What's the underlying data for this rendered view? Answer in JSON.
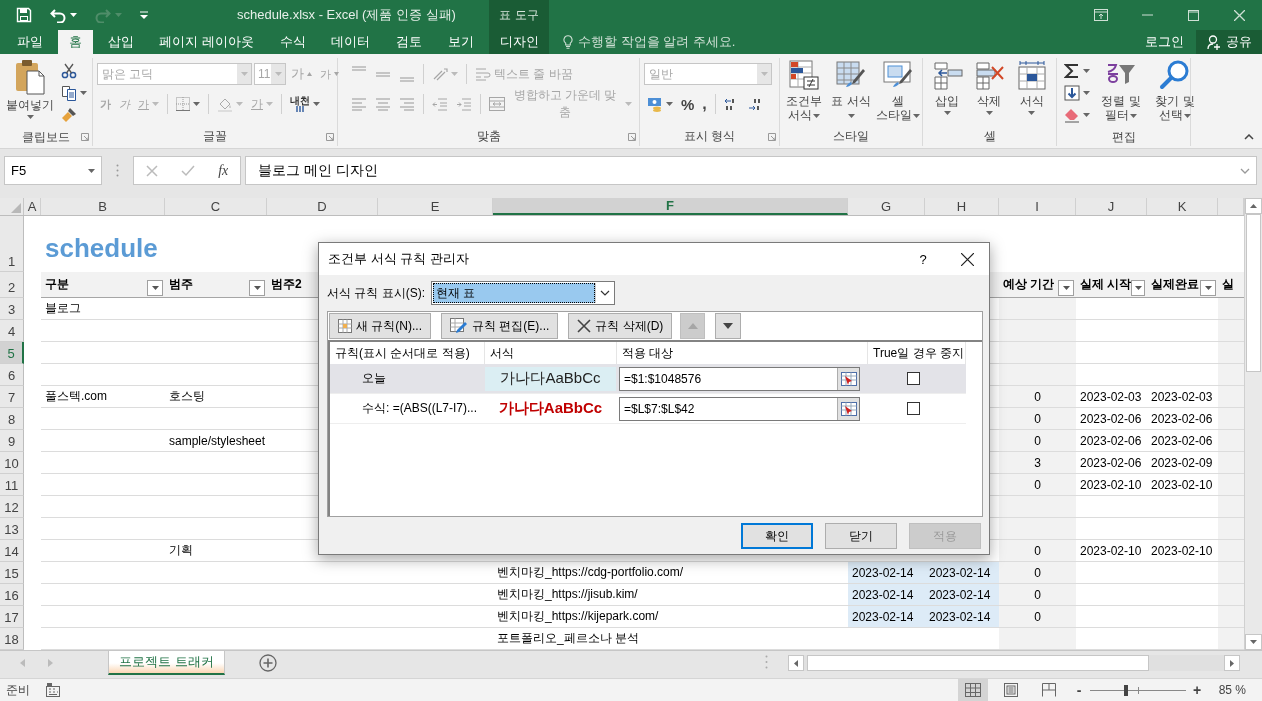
{
  "title_bar": {
    "title": "schedule.xlsx - Excel (제품 인증 실패)",
    "context_label": "표 도구"
  },
  "ribbon_tabs": [
    {
      "label": "파일",
      "selected": false,
      "kind": "normal"
    },
    {
      "label": "홈",
      "selected": true,
      "kind": "normal"
    },
    {
      "label": "삽입",
      "selected": false,
      "kind": "normal"
    },
    {
      "label": "페이지 레이아웃",
      "selected": false,
      "kind": "normal"
    },
    {
      "label": "수식",
      "selected": false,
      "kind": "normal"
    },
    {
      "label": "데이터",
      "selected": false,
      "kind": "normal"
    },
    {
      "label": "검토",
      "selected": false,
      "kind": "normal"
    },
    {
      "label": "보기",
      "selected": false,
      "kind": "normal"
    },
    {
      "label": "디자인",
      "selected": false,
      "kind": "contextual"
    }
  ],
  "tell_me": {
    "placeholder": "수행할 작업을 알려 주세요."
  },
  "account": {
    "login": "로그인",
    "share": "공유"
  },
  "ribbon": {
    "clipboard": {
      "label": "클립보드",
      "paste": "붙여넣기"
    },
    "font": {
      "label": "글꼴",
      "disabled": true,
      "font_name": "맑은 고딕",
      "font_size": "11",
      "grow": "가",
      "shrink": "가",
      "bold": "가",
      "italic": "가",
      "underline": "가",
      "font_color": "가",
      "phonetic": "내천"
    },
    "alignment": {
      "label": "맞춤",
      "disabled": true,
      "wrap_text": "텍스트 줄 바꿈",
      "merge_center": "병합하고 가운데 맞춤"
    },
    "number": {
      "label": "표시 형식",
      "disabled": true,
      "format": "일반",
      "percent": "%",
      "comma": ","
    },
    "styles": {
      "label": "스타일",
      "buttons": [
        "조건부 서식",
        "표 서식",
        "셀 스타일"
      ]
    },
    "cells": {
      "label": "셀",
      "buttons": [
        "삽입",
        "삭제",
        "서식"
      ]
    },
    "editing": {
      "label": "편집",
      "buttons": [
        "정렬 및 필터",
        "찾기 및 선택"
      ]
    }
  },
  "formula_bar": {
    "name_box": "F5",
    "function_button": "fx",
    "formula": "블로그 메인 디자인"
  },
  "sheet": {
    "columns": [
      {
        "label": "A",
        "selected": false
      },
      {
        "label": "B",
        "selected": false,
        "banded": false
      },
      {
        "label": "C",
        "selected": false,
        "banded": false
      },
      {
        "label": "D",
        "selected": false,
        "banded": false
      },
      {
        "label": "E",
        "selected": false,
        "banded": false
      },
      {
        "label": "F",
        "selected": true,
        "banded": false
      },
      {
        "label": "G",
        "selected": false,
        "banded": false
      },
      {
        "label": "H",
        "selected": false,
        "banded": false
      },
      {
        "label": "I",
        "selected": false,
        "banded": true
      },
      {
        "label": "J",
        "selected": false,
        "banded": false
      },
      {
        "label": "K",
        "selected": false,
        "banded": false
      },
      {
        "banded": true
      }
    ],
    "rows": [
      {
        "label": "1",
        "selected": false,
        "kind": "title",
        "title": "schedule"
      },
      {
        "label": "2",
        "selected": false,
        "kind": "header",
        "headers": {
          "B": {
            "label": "구분",
            "filter": true
          },
          "C": {
            "label": "범주",
            "filter": true
          },
          "D": {
            "label": "범주2"
          },
          "I": {
            "label": "예상 기간",
            "filter": true
          },
          "J": {
            "label": "실제 시작",
            "filter": true
          },
          "K": {
            "label": "실제완료",
            "filter": true
          },
          "L": {
            "label": "실"
          }
        }
      },
      {
        "label": "3",
        "selected": false,
        "kind": "data",
        "cells": {
          "B": {
            "text": "블로그",
            "highlighted": false
          }
        }
      },
      {
        "label": "4",
        "selected": false,
        "kind": "data"
      },
      {
        "label": "5",
        "selected": true,
        "kind": "data"
      },
      {
        "label": "6",
        "selected": false,
        "kind": "data"
      },
      {
        "label": "7",
        "selected": false,
        "kind": "data",
        "cells": {
          "B": {
            "text": "풀스텍.com",
            "highlighted": false
          },
          "C": {
            "text": "호스팅",
            "highlighted": false
          },
          "I": {
            "text": "0",
            "highlighted": false
          },
          "J": {
            "text": "2023-02-03",
            "highlighted": false
          },
          "K": {
            "text": "2023-02-03",
            "highlighted": false
          }
        }
      },
      {
        "label": "8",
        "selected": false,
        "kind": "data",
        "cells": {
          "I": {
            "text": "0",
            "highlighted": false
          },
          "J": {
            "text": "2023-02-06",
            "highlighted": false
          },
          "K": {
            "text": "2023-02-06",
            "highlighted": false
          }
        }
      },
      {
        "label": "9",
        "selected": false,
        "kind": "data",
        "cells": {
          "C": {
            "text": "sample/stylesheet",
            "highlighted": false
          },
          "I": {
            "text": "0",
            "highlighted": false
          },
          "J": {
            "text": "2023-02-06",
            "highlighted": false
          },
          "K": {
            "text": "2023-02-06",
            "highlighted": false
          }
        }
      },
      {
        "label": "10",
        "selected": false,
        "kind": "data",
        "cells": {
          "I": {
            "text": "3",
            "highlighted": false
          },
          "J": {
            "text": "2023-02-06",
            "highlighted": false
          },
          "K": {
            "text": "2023-02-09",
            "highlighted": false
          }
        }
      },
      {
        "label": "11",
        "selected": false,
        "kind": "data",
        "cells": {
          "I": {
            "text": "0",
            "highlighted": false
          },
          "J": {
            "text": "2023-02-10",
            "highlighted": false
          },
          "K": {
            "text": "2023-02-10",
            "highlighted": false
          }
        }
      },
      {
        "label": "12",
        "selected": false,
        "kind": "data"
      },
      {
        "label": "13",
        "selected": false,
        "kind": "data"
      },
      {
        "label": "14",
        "selected": false,
        "kind": "data",
        "cells": {
          "C": {
            "text": "기획",
            "highlighted": false
          },
          "I": {
            "text": "0",
            "highlighted": false
          },
          "J": {
            "text": "2023-02-10",
            "highlighted": false
          },
          "K": {
            "text": "2023-02-10",
            "highlighted": false
          }
        }
      },
      {
        "label": "15",
        "selected": false,
        "kind": "data",
        "cells": {
          "F": {
            "text": "벤치마킹_https://cdg-portfolio.com/",
            "highlighted": false
          },
          "G": {
            "text": "2023-02-14",
            "highlighted": true
          },
          "H": {
            "text": "2023-02-14",
            "highlighted": true
          },
          "I": {
            "text": "0",
            "highlighted": false
          }
        }
      },
      {
        "label": "16",
        "selected": false,
        "kind": "data",
        "cells": {
          "F": {
            "text": "벤치마킹_https://jisub.kim/",
            "highlighted": false
          },
          "G": {
            "text": "2023-02-14",
            "highlighted": true
          },
          "H": {
            "text": "2023-02-14",
            "highlighted": true
          },
          "I": {
            "text": "0",
            "highlighted": false
          }
        }
      },
      {
        "label": "17",
        "selected": false,
        "kind": "data",
        "cells": {
          "F": {
            "text": "벤치마킹_https://kijepark.com/",
            "highlighted": false
          },
          "G": {
            "text": "2023-02-14",
            "highlighted": true
          },
          "H": {
            "text": "2023-02-14",
            "highlighted": true
          },
          "I": {
            "text": "0",
            "highlighted": false
          }
        }
      },
      {
        "label": "18",
        "selected": false,
        "kind": "data",
        "cells": {
          "F": {
            "text": "포트폴리오_페르소나 분석",
            "highlighted": false
          }
        }
      }
    ]
  },
  "sheet_tabs": {
    "tabs": [
      {
        "label": "프로젝트 트래커",
        "selected": true
      }
    ]
  },
  "status_bar": {
    "status": "준비",
    "views": [
      {
        "kind": "normal",
        "selected": true
      },
      {
        "kind": "page-layout",
        "selected": false
      },
      {
        "kind": "page-break",
        "selected": false
      }
    ],
    "zoom_out": "-",
    "zoom_in": "+",
    "zoom": {
      "level": 0.38,
      "reading": "85 %"
    }
  },
  "dialog": {
    "title": "조건부 서식 규칙 관리자",
    "help": "?",
    "show_label": "서식 규칙 표시(S):",
    "show_value": "현재 표",
    "toolbar": [
      {
        "kind": "new",
        "label": "새 규칙(N)...",
        "disabled": false
      },
      {
        "kind": "edit",
        "label": "규칙 편집(E)...",
        "disabled": false
      },
      {
        "kind": "delete",
        "label": "규칙 삭제(D)",
        "disabled": false
      },
      {
        "kind": "up",
        "disabled": true
      },
      {
        "kind": "down",
        "disabled": false
      }
    ],
    "columns": [
      "규칙(표시 순서대로 적용)",
      "서식",
      "적용 대상",
      "True일 경우 중지"
    ],
    "rules": [
      {
        "rule": "오늘",
        "preview": "가나다AaBbCc",
        "kind": "fill",
        "applies_to": "=$1:$1048576",
        "stop_if_true": false,
        "selected": true
      },
      {
        "rule": "수식: =(ABS((L7-I7)...",
        "preview": "가나다AaBbCc",
        "kind": "bold",
        "applies_to": "=$L$7:$L$42",
        "stop_if_true": false,
        "selected": false
      }
    ],
    "buttons": [
      {
        "label": "확인",
        "default": true,
        "disabled": false
      },
      {
        "label": "닫기",
        "default": false,
        "disabled": false
      },
      {
        "label": "적용",
        "default": false,
        "disabled": true
      }
    ]
  }
}
